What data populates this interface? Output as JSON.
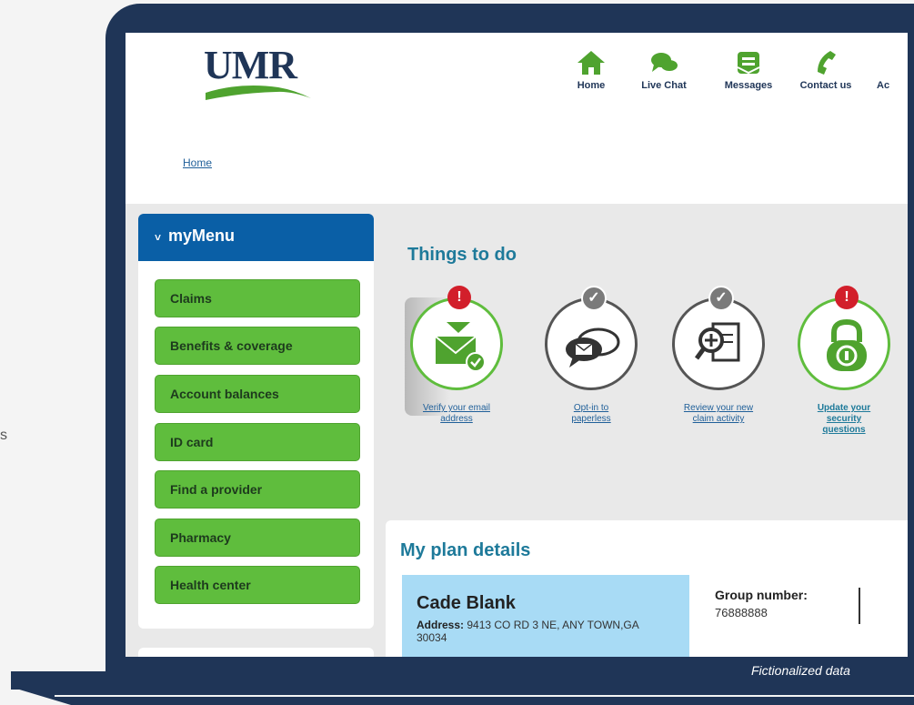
{
  "stray_text": "s",
  "disclaimer": "Fictionalized data",
  "header": {
    "logo": "UMR",
    "nav": [
      {
        "label": "Home",
        "icon": "home-icon"
      },
      {
        "label": "Live Chat",
        "icon": "chat-icon"
      },
      {
        "label": "Messages",
        "icon": "messages-icon"
      },
      {
        "label": "Contact us",
        "icon": "phone-icon"
      },
      {
        "label": "Ac",
        "icon": ""
      }
    ],
    "breadcrumb": "Home"
  },
  "sidebar": {
    "title": "myMenu",
    "items": [
      "Claims",
      "Benefits & coverage",
      "Account balances",
      "ID card",
      "Find a provider",
      "Pharmacy",
      "Health center"
    ]
  },
  "things_to_do": {
    "title": "Things to do",
    "items": [
      {
        "label": "Verify your email address",
        "status": "!",
        "icon": "email-verify-icon"
      },
      {
        "label": "Opt-in to paperless",
        "status": "check",
        "icon": "speech-bubbles-icon"
      },
      {
        "label": "Review your new claim activity",
        "status": "check",
        "icon": "document-magnifier-icon"
      },
      {
        "label": "Update your security questions",
        "status": "!",
        "icon": "padlock-icon"
      }
    ]
  },
  "plan_details": {
    "title": "My plan details",
    "member_name": "Cade Blank",
    "address_label": "Address:",
    "address": "9413 CO RD 3 NE, ANY TOWN,GA 30034",
    "group_label": "Group number:",
    "group_number": "76888888"
  },
  "colors": {
    "navy": "#1f3557",
    "menu_blue": "#0a5fa6",
    "menu_green": "#5fbd3d",
    "teal_heading": "#1e7a9a",
    "alert_red": "#d21f2b"
  }
}
